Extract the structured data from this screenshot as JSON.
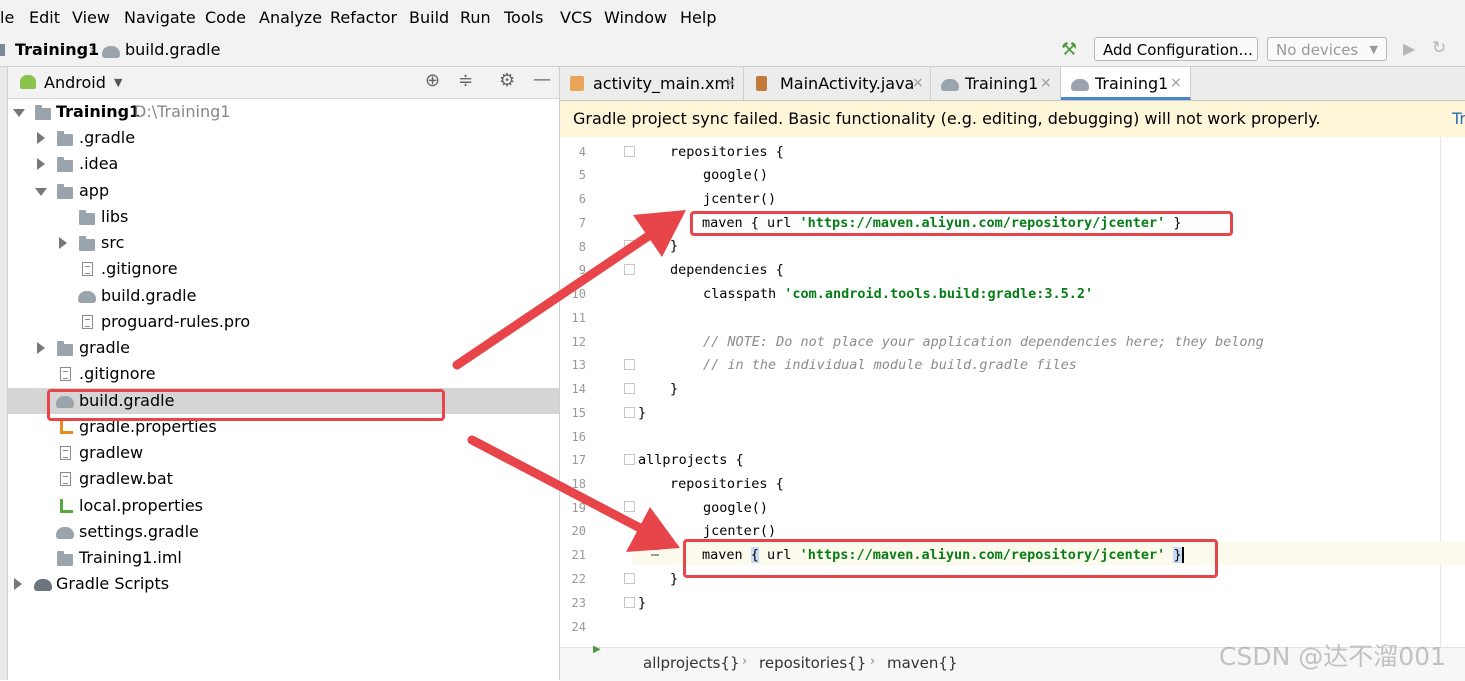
{
  "menu": [
    "le",
    "Edit",
    "View",
    "Navigate",
    "Code",
    "Analyze",
    "Refactor",
    "Build",
    "Run",
    "Tools",
    "VCS",
    "Window",
    "Help"
  ],
  "nav": {
    "project": "Training1",
    "file": "build.gradle",
    "add_config": "Add Configuration...",
    "devices": "No devices"
  },
  "project_panel": {
    "mode": "Android",
    "tree": [
      {
        "label": "Training1",
        "extra": "D:\\Training1",
        "bold": true
      },
      {
        "label": ".gradle"
      },
      {
        "label": ".idea"
      },
      {
        "label": "app"
      },
      {
        "label": "libs"
      },
      {
        "label": "src"
      },
      {
        "label": ".gitignore"
      },
      {
        "label": "build.gradle"
      },
      {
        "label": "proguard-rules.pro"
      },
      {
        "label": "gradle"
      },
      {
        "label": ".gitignore"
      },
      {
        "label": "build.gradle"
      },
      {
        "label": "gradle.properties"
      },
      {
        "label": "gradlew"
      },
      {
        "label": "gradlew.bat"
      },
      {
        "label": "local.properties"
      },
      {
        "label": "settings.gradle"
      },
      {
        "label": "Training1.iml"
      },
      {
        "label": "Gradle Scripts"
      }
    ]
  },
  "tabs": [
    "activity_main.xml",
    "MainActivity.java",
    "Training1",
    "Training1"
  ],
  "banner": {
    "text": "Gradle project sync failed. Basic functionality (e.g. editing, debugging) will not work properly.",
    "link": "Tr"
  },
  "code": {
    "line_numbers": [
      "4",
      "5",
      "6",
      "7",
      "8",
      "9",
      "10",
      "11",
      "12",
      "13",
      "14",
      "15",
      "16",
      "17",
      "18",
      "19",
      "20",
      "21",
      "22",
      "23",
      "24"
    ],
    "repositories": "repositories {",
    "google": "google()",
    "jcenter": "jcenter()",
    "maven_pre": "maven { url ",
    "maven_url": "'https://maven.aliyun.com/repository/jcenter'",
    "maven_post": " }",
    "close_brace": "}",
    "dependencies": "dependencies {",
    "classpath_pre": "classpath ",
    "classpath_val": "'com.android.tools.build:gradle:3.5.2'",
    "comment1": "// NOTE: Do not place your application dependencies here; they belong",
    "comment2": "// in the individual module build.gradle files",
    "allprojects": "allprojects {",
    "maven2_pre": "maven ",
    "maven2_brace": "{",
    "maven2_mid": " url ",
    "maven2_url": "'https://maven.aliyun.com/repository/jcenter'",
    "maven2_close": "}"
  },
  "breadcrumb": [
    "allprojects{}",
    "repositories{}",
    "maven{}"
  ],
  "watermark": "CSDN @达不溜001",
  "colors": {
    "annotation": "#e8454a",
    "string": "#067d17",
    "banner": "#fdf6d8"
  }
}
